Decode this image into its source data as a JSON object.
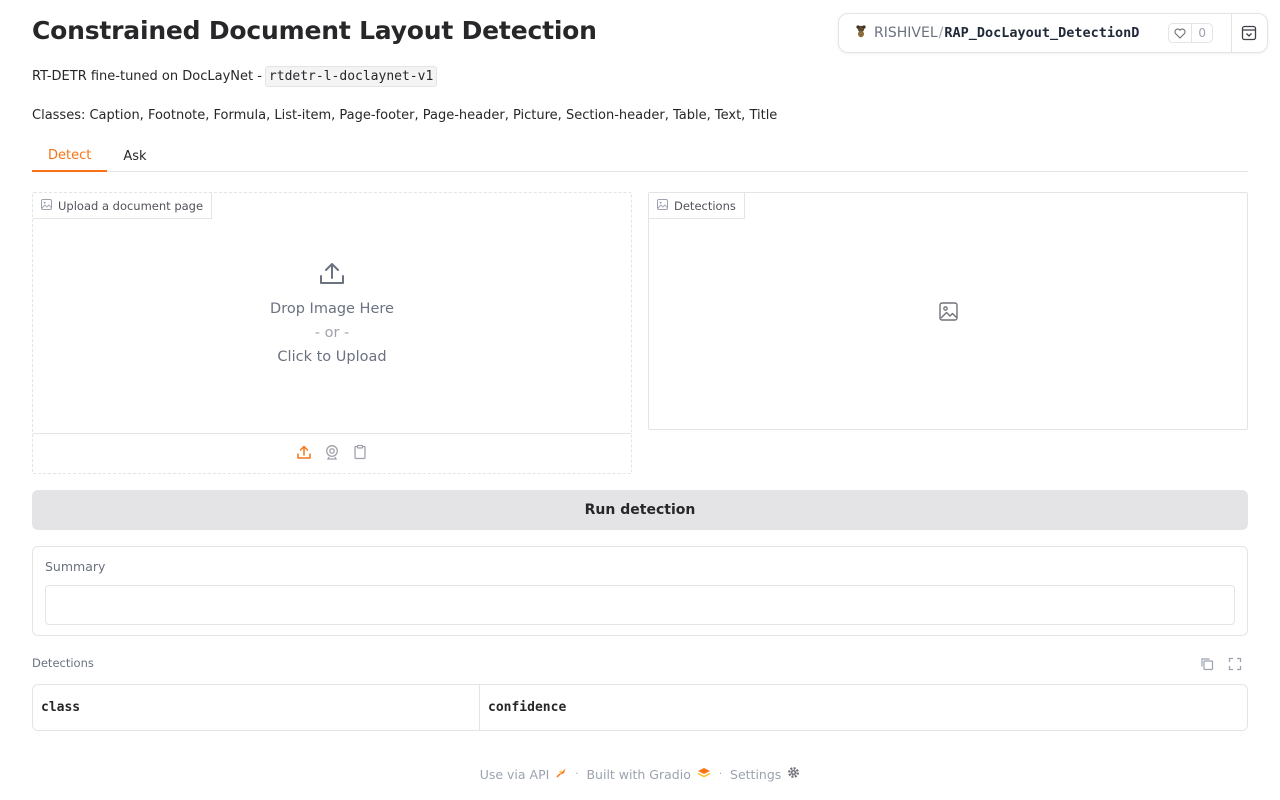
{
  "header": {
    "title": "Constrained Document Layout Detection",
    "subtitle_text": "RT-DETR fine-tuned on DocLayNet -",
    "model_code": "rtdetr-l-doclaynet-v1",
    "classes_text": "Classes: Caption, Footnote, Formula, List-item, Page-footer, Page-header, Picture, Section-header, Table, Text, Title"
  },
  "space_badge": {
    "owner": "RISHIVEL",
    "separator": "/",
    "repo": "RAP_DocLayout_DetectionD",
    "like_count": "0",
    "logo_icon": "space-logo-icon",
    "heart_icon": "heart-icon",
    "collapse_icon": "collapse-icon"
  },
  "tabs": [
    {
      "label": "Detect",
      "active": true
    },
    {
      "label": "Ask",
      "active": false
    }
  ],
  "upload_panel": {
    "label": "Upload a document page",
    "drop_text": "Drop Image Here",
    "or_text": "- or -",
    "click_text": "Click to Upload",
    "toolbar_icons": [
      "upload-icon",
      "webcam-icon",
      "clipboard-icon"
    ]
  },
  "output_panel": {
    "label": "Detections"
  },
  "run_button": {
    "label": "Run detection"
  },
  "summary": {
    "label": "Summary",
    "value": ""
  },
  "detections_table": {
    "label": "Detections",
    "columns": [
      "class",
      "confidence"
    ],
    "rows": []
  },
  "footer": {
    "api_text": "Use via API",
    "built_text": "Built with Gradio",
    "settings_text": "Settings",
    "separator": "·"
  },
  "colors": {
    "accent": "#f97316",
    "border": "#e4e4e7",
    "button_bg": "#e4e4e7"
  }
}
